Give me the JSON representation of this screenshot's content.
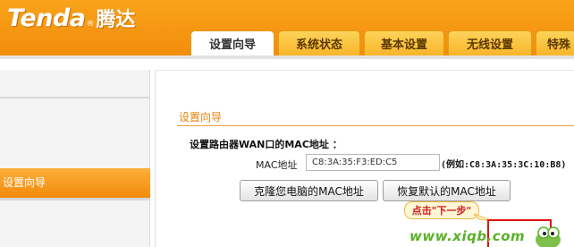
{
  "brand": {
    "logo_en": "Tenda",
    "logo_reg": "®",
    "logo_cn": "腾达"
  },
  "tabs": [
    {
      "label": "设置向导",
      "active": true
    },
    {
      "label": "系统状态",
      "active": false
    },
    {
      "label": "基本设置",
      "active": false
    },
    {
      "label": "无线设置",
      "active": false
    },
    {
      "label": "特殊",
      "active": false
    }
  ],
  "sidebar": {
    "items": [
      {
        "label": "设置向导",
        "active": true
      }
    ]
  },
  "main": {
    "section_title": "设置向导",
    "subtitle": "设置路由器WAN口的MAC地址 ：",
    "mac_label": "MAC地址",
    "mac_value": "C8:3A:35:F3:ED:C5",
    "example": "(例如:C8:3A:35:3C:10:B8)",
    "clone_button": "克隆您电脑的MAC地址",
    "restore_button": "恢复默认的MAC地址"
  },
  "annotation": {
    "callout": "点击\"下一步\""
  },
  "watermark": "www.xiqb.com",
  "colors": {
    "brand_orange": "#f28e0c",
    "accent_text": "#e8820c",
    "highlight_red": "#e01414",
    "watermark_green": "#5ab227"
  }
}
